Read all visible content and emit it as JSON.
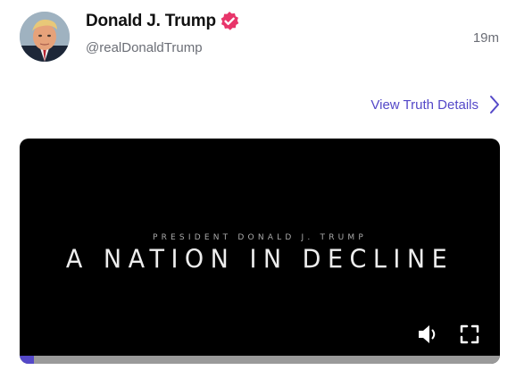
{
  "author": {
    "display_name": "Donald J. Trump",
    "handle": "@realDonaldTrump",
    "verified": true,
    "avatar_icon": "profile-photo"
  },
  "post": {
    "timestamp": "19m",
    "details_link_label": "View Truth Details"
  },
  "video": {
    "subtitle": "PRESIDENT DONALD J. TRUMP",
    "title": "A NATION IN DECLINE",
    "progress": 0.03,
    "volume_icon": "speaker-icon",
    "fullscreen_icon": "fullscreen-icon"
  },
  "colors": {
    "accent": "#5448c8",
    "verified_badge": "#e8356a",
    "muted_text": "#6b6e76",
    "video_bg": "#000000"
  }
}
